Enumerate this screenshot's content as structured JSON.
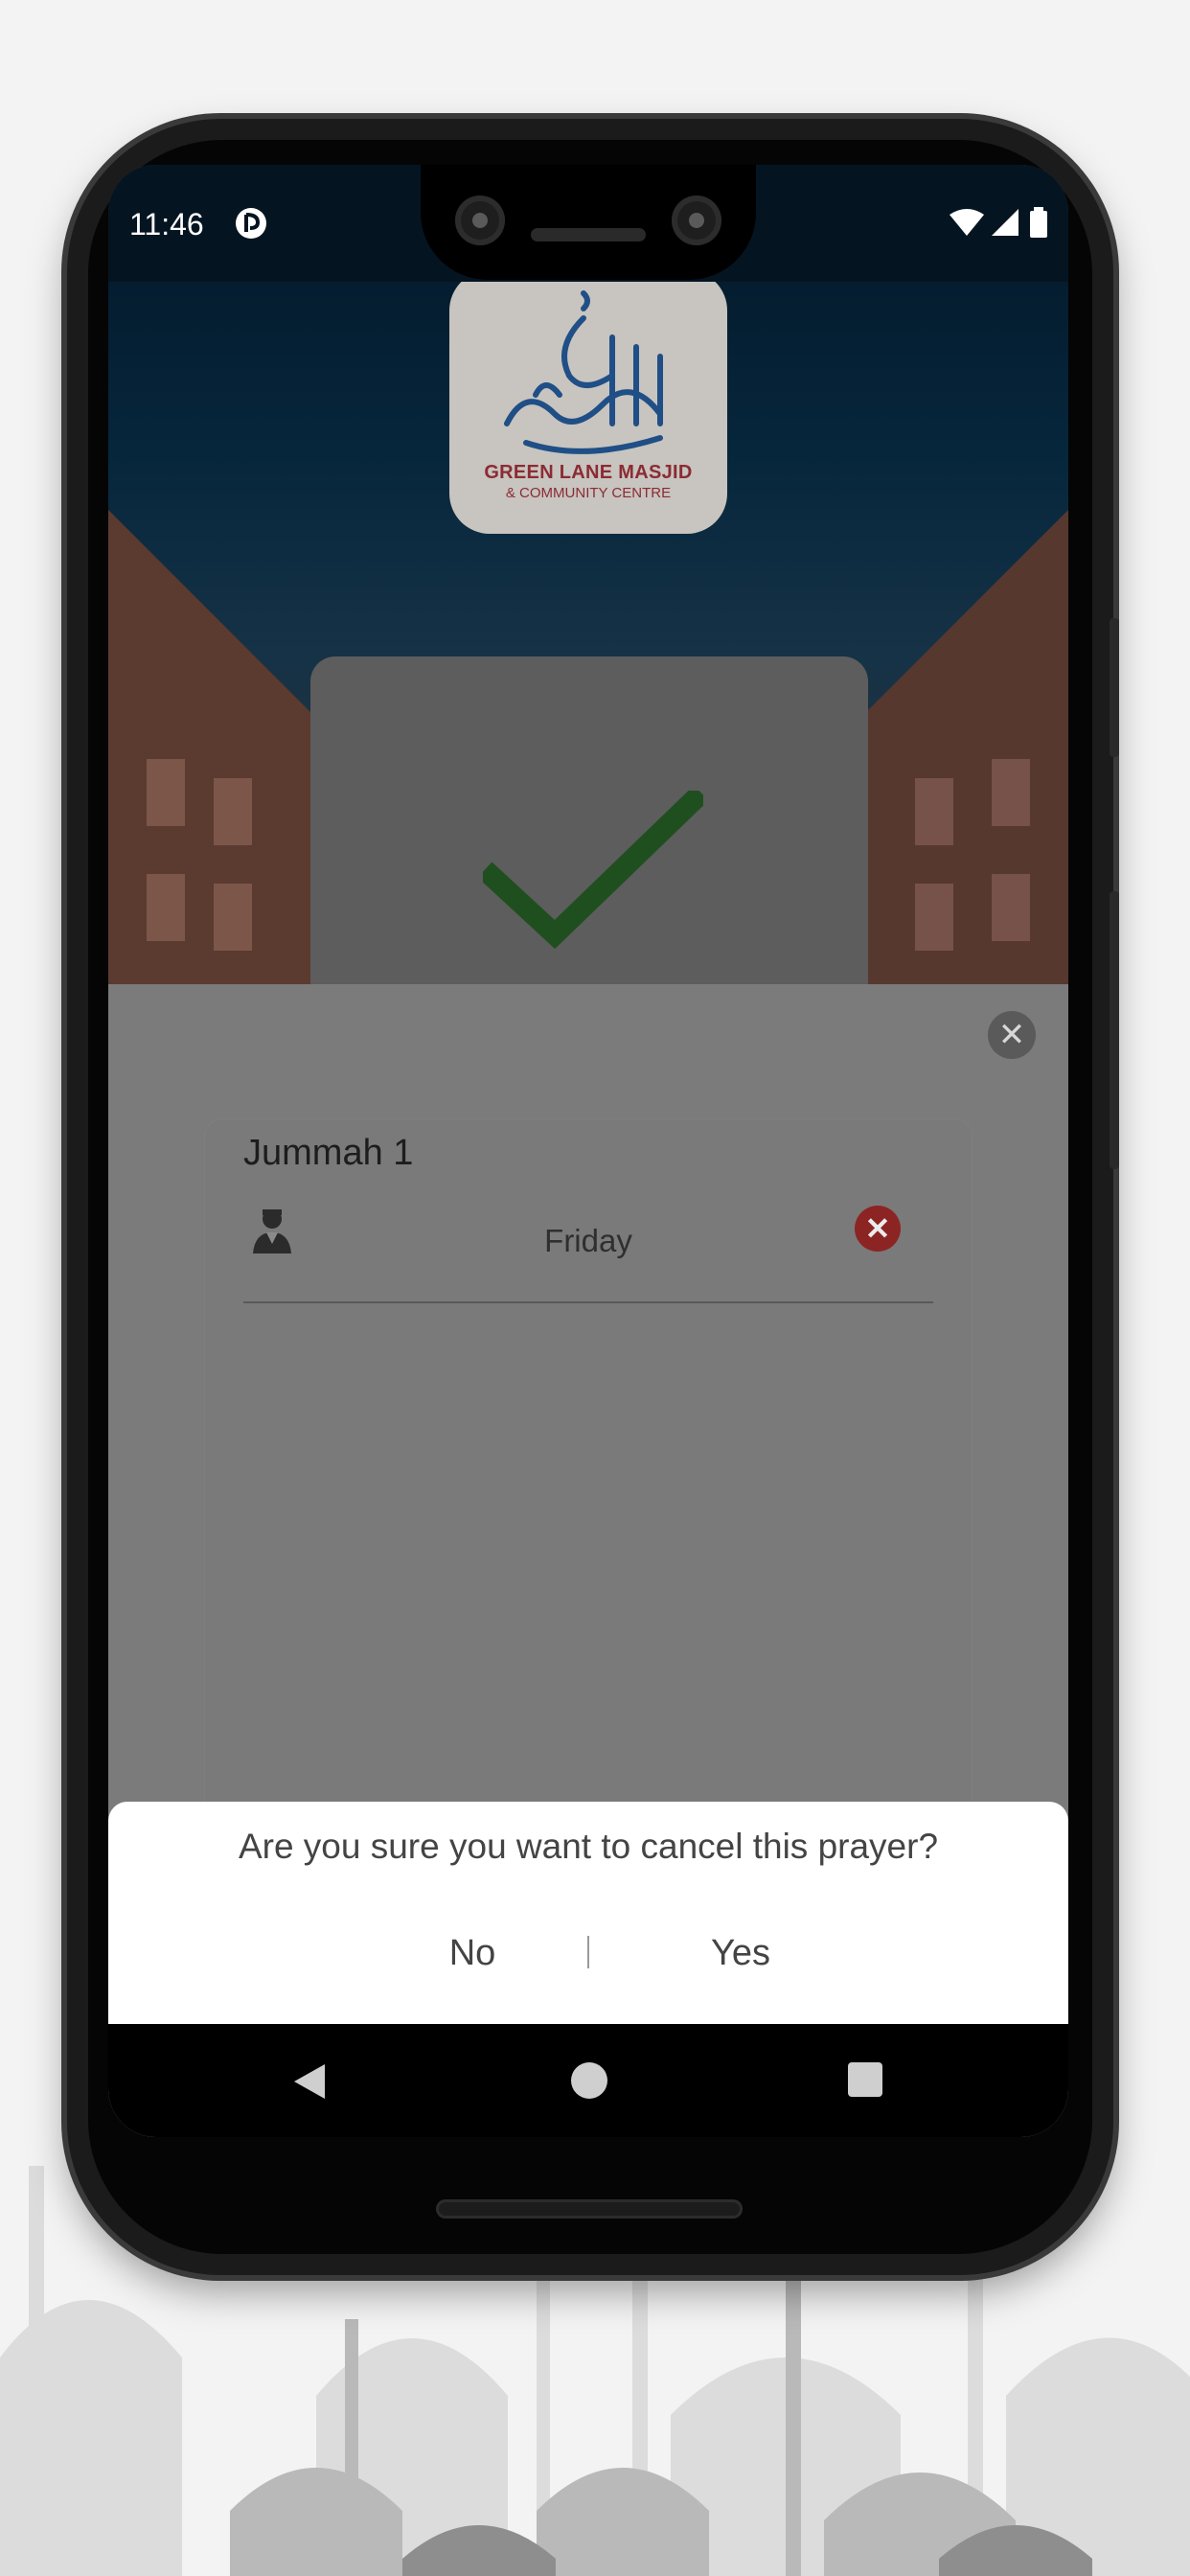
{
  "status_bar": {
    "time": "11:46",
    "notification_icon": "app-notification-icon",
    "icons": [
      "wifi-icon",
      "signal-icon",
      "battery-icon"
    ]
  },
  "logo": {
    "title": "GREEN LANE MASJID",
    "subtitle": "& COMMUNITY CENTRE",
    "brand_color": "#8b2b34",
    "calligraphy_color": "#1f4f86"
  },
  "success_card": {
    "icon": "checkmark-icon",
    "icon_color": "#1f4f1f"
  },
  "panel": {
    "close_icon": "close-icon",
    "prayer": {
      "title": "Jummah 1",
      "day": "Friday",
      "person_icon": "imam-icon",
      "remove_icon": "remove-icon",
      "remove_color": "#8d2424"
    }
  },
  "dialog": {
    "message": "Are you sure you want to cancel this prayer?",
    "no_label": "No",
    "yes_label": "Yes"
  },
  "nav_bar": {
    "back": "back-icon",
    "home": "home-icon",
    "recents": "recents-icon"
  }
}
